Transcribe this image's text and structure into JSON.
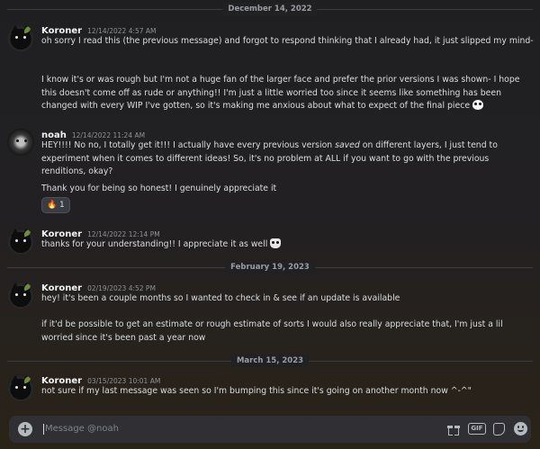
{
  "dividers": [
    "December 14, 2022",
    "February 19, 2023",
    "March 15, 2023"
  ],
  "messages": [
    {
      "author": "Koroner",
      "time": "12/14/2022 4:57 AM",
      "lines": [
        "oh sorry I read this (the previous message) and forgot to respond thinking that I already had, it just slipped my mind-",
        "I know it's or was rough but I'm not a huge fan of the larger face and prefer the prior versions I was shown- I hope this doesn't come off as rude or anything!! I'm just a little worried too since it seems like something has been changed with every WIP I've gotten, so it's making me anxious about what to expect of the final piece"
      ]
    },
    {
      "author": "noah",
      "time": "12/14/2022 11:24 AM",
      "line1_pre": "HEY!!!! No no, I totally get it!!! I actually have every previous version ",
      "line1_em": "saved",
      "line1_post": " on different layers, I just tend to experiment when it comes to different ideas! So, it's no problem at ALL if you want to go with the previous renditions, okay?",
      "line2": "Thank you for being so honest! I genuinely appreciate it",
      "reaction": {
        "emoji": "🔥",
        "count": "1"
      }
    },
    {
      "author": "Koroner",
      "time": "12/14/2022 12:14 PM",
      "lines": [
        "thanks for your understanding!! I appreciate it as well"
      ]
    },
    {
      "author": "Koroner",
      "time": "02/19/2023 4:52 PM",
      "lines": [
        "hey! it's been a couple months so I wanted to check in & see if an update is available",
        "if it'd be possible to get an estimate or rough estimate of sorts I would also really appreciate that, I'm just a lil worried since it's been past a year now"
      ]
    },
    {
      "author": "Koroner",
      "time": "03/15/2023 10:01 AM",
      "lines": [
        "not sure if my last message was seen so I'm bumping this since it's going on another month now ^-^\""
      ]
    }
  ],
  "composer": {
    "placeholder": "Message @noah",
    "tools": {
      "gif_label": "GIF"
    },
    "icons": [
      "plus-circle-icon",
      "gift-icon",
      "gif-icon",
      "sticker-icon",
      "emoji-icon"
    ]
  },
  "colors": {
    "accent": "#5865f2",
    "background": "#222023",
    "text": "#dbdee1"
  }
}
